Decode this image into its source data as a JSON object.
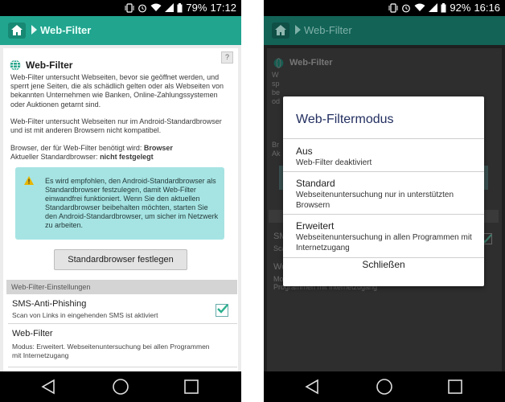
{
  "left": {
    "status": {
      "battery": "79%",
      "time": "17:12"
    },
    "appbar": {
      "title": "Web-Filter"
    },
    "help": "?",
    "webfilter": {
      "title": "Web-Filter",
      "p1": "Web-Filter untersucht Webseiten, bevor sie geöffnet werden, und sperrt jene Seiten, die als schädlich gelten oder als Webseiten von bekannten Unternehmen wie Banken, Online-Zahlungssystemen oder Auktionen getarnt sind.",
      "p2": "Web-Filter untersucht Webseiten nur im Android-Standardbrowser und ist mit anderen Browsern nicht kompatibel.",
      "browser_label": "Browser, der für Web-Filter benötigt wird: ",
      "browser_value": "Browser",
      "default_label": "Aktueller Standardbrowser: ",
      "default_value": "nicht festgelegt"
    },
    "alert": "Es wird empfohlen, den Android-Standardbrowser als Standardbrowser festzulegen, damit Web-Filter einwandfrei funktioniert. Wenn Sie den aktuellen Standardbrowser beibehalten möchten, starten Sie den Android-Standardbrowser, um sicher im Netzwerk zu arbeiten.",
    "button": "Standardbrowser festlegen",
    "section": "Web-Filter-Einstellungen",
    "sms": {
      "title": "SMS-Anti-Phishing",
      "sub": "Scan von Links in eingehenden SMS ist aktiviert",
      "checked": true
    },
    "filter_row": {
      "title": "Web-Filter",
      "sub": "Modus: Erweitert. Webseitenuntersuchung bei allen Programmen mit Internetzugang"
    }
  },
  "right": {
    "status": {
      "battery": "92%",
      "time": "16:16"
    },
    "appbar": {
      "title": "Web-Filter"
    },
    "bg": {
      "title": "Web-Filter",
      "w1": "W",
      "w2": "sp",
      "w3": "be",
      "w4": "od",
      "b1": "Br",
      "b2": "Ak",
      "sms_t": "SM",
      "sms_s": "Sca",
      "web_t": "We",
      "web_s1": "Mo",
      "web_s2": "Programmen mit Internetzugang"
    },
    "dialog": {
      "title": "Web-Filtermodus",
      "options": [
        {
          "title": "Aus",
          "sub": "Web-Filter deaktiviert"
        },
        {
          "title": "Standard",
          "sub": "Webseitenuntersuchung nur in unterstützten Browsern"
        },
        {
          "title": "Erweitert",
          "sub": "Webseitenuntersuchung in allen Programmen mit Internetzugang"
        }
      ],
      "close": "Schließen"
    }
  },
  "colors": {
    "accent": "#21a58f",
    "alert": "#a6e4e3",
    "dialog_title": "#232f60"
  }
}
